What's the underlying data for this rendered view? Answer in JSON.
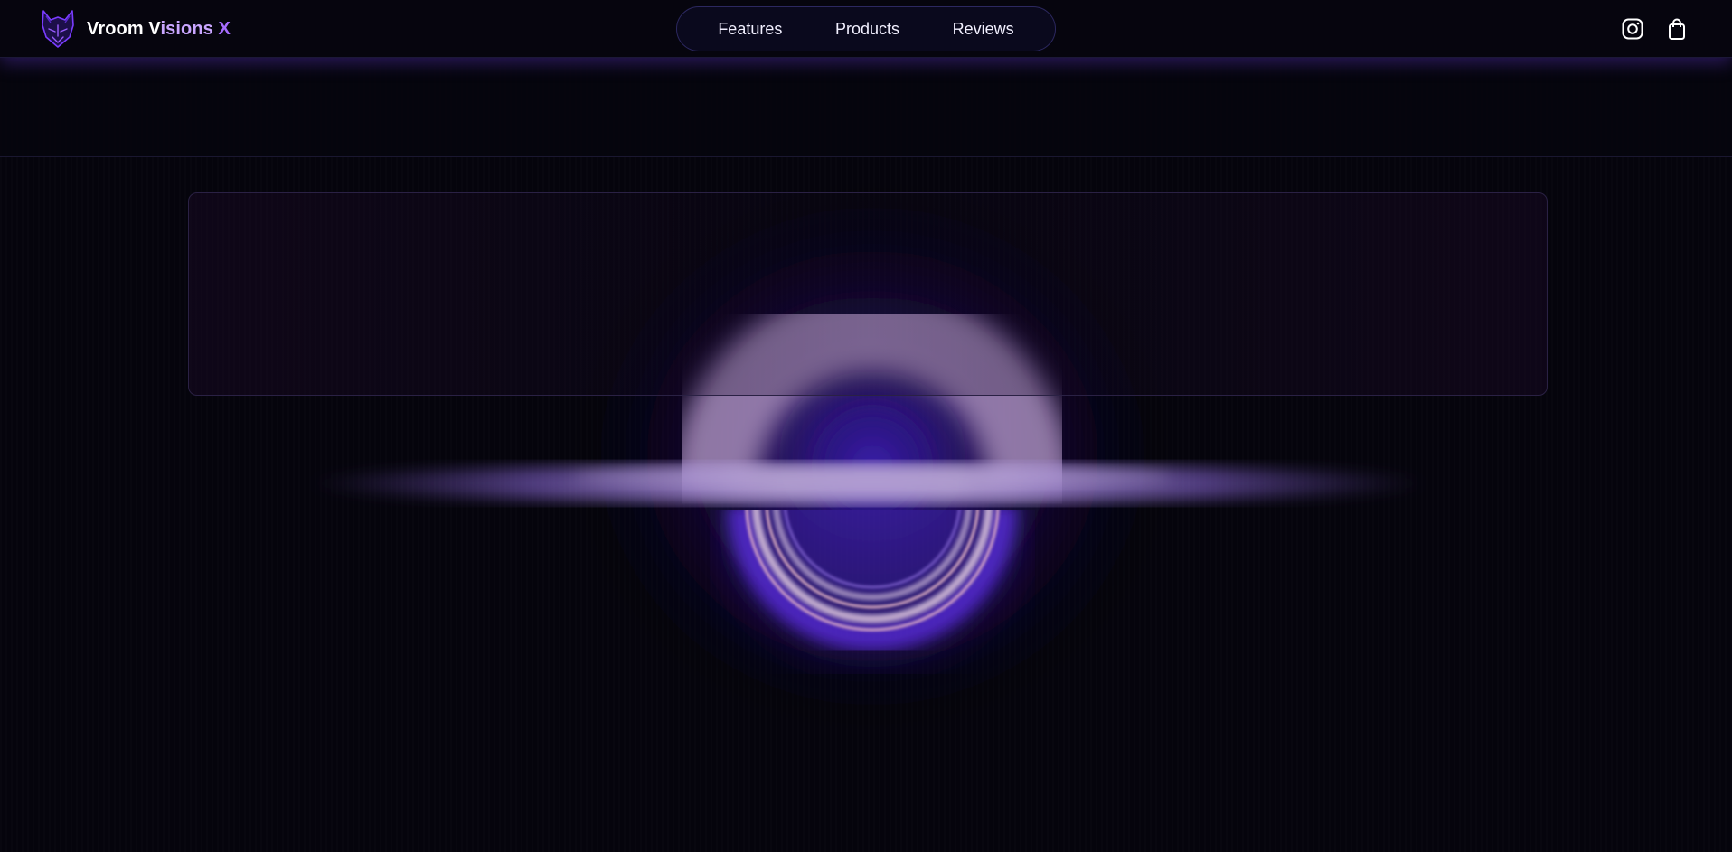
{
  "brand": {
    "name_part1": "Vroom V",
    "name_part2": "isions",
    "name_part3": " X",
    "logo_icon": "wolf-head-icon"
  },
  "nav": {
    "items": [
      {
        "label": "Features"
      },
      {
        "label": "Products"
      },
      {
        "label": "Reviews"
      }
    ]
  },
  "header_actions": {
    "instagram_icon": "instagram-icon",
    "cart_icon": "shopping-bag-icon"
  },
  "colors": {
    "background": "#05040c",
    "accent": "#a66cff",
    "accent_light": "#c9a6ff",
    "glow": "#6a3cff"
  }
}
